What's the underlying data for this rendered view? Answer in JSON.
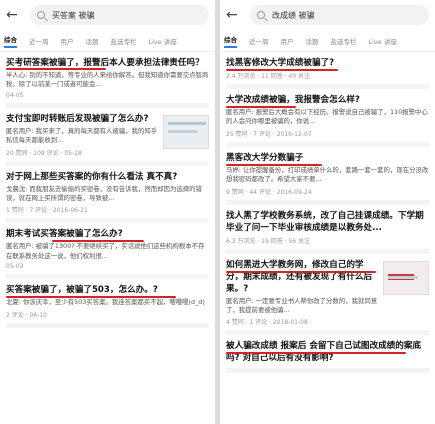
{
  "left": {
    "back_icon": "arrow-left-icon",
    "query": "买答案 被骗",
    "tabs": [
      "综合",
      "近一周",
      "用户",
      "话题",
      "盐选专栏",
      "Live 讲座"
    ],
    "items": [
      {
        "title": "买考研答案被骗了，报警后本人要承担法律责任吗？",
        "body": "半人心: 别的不知道，等专业的人来给你解答。但我知道你需要交点智商税。除了以前某一门或者可能会...",
        "meta": "04-05"
      },
      {
        "title": "支付宝即时转账后发现被骗了怎么办?",
        "body": "匿名用户: 我买来了，真的每天都有人被骗，我的知乎私信每天都能收到...",
        "meta": "20 赞同 · 109 评论 · 05-18"
      },
      {
        "title": "对于网上那些买答案的你有什么看法 真不真?",
        "body": "戈晨沈: 而我朋友去偷偷的买密卷，没有告诉我，然而却因为选择的错误，就在网上买所谓的密卷，导致被...",
        "meta": "1 赞同 · 7 评论 · 2016-06-21"
      },
      {
        "title": "期末考试买答案被骗了怎么办?",
        "body": "匿名用户: 被骗了1300? 不要继续买了，实话说他们这些机构根本不存在联系教务处这一说，他们权利很...",
        "meta": "05-03"
      },
      {
        "title": "买答案被骗了，被骗了503，怎么办。?",
        "body": "北夏: 你该庆幸，至少有503买答案。我连答案都买不起，嘤嘤嘤(d_d)",
        "meta": "2 评论 · 06-10"
      }
    ]
  },
  "right": {
    "back_icon": "arrow-left-icon",
    "query": "改成绩 被骗",
    "tabs": [
      "综合",
      "近一周",
      "用户",
      "话题",
      "盐选专栏",
      "Live 讲座"
    ],
    "items": [
      {
        "title": "找黑客修改大学成绩被骗了?",
        "body": "",
        "meta": "2.4 万浏览 · 11 回答 · 40 关注"
      },
      {
        "title": "大学改成绩被骗，我报警会怎么样?",
        "body": "匿名用户: 报警后大概会有以下经历。报警说自己被骗了，110报警中心的人会问你哪里被骗的，你说...",
        "meta": "25 赞同 · 7 评论 · 2016-12-07"
      },
      {
        "title": "黑客改大学分数骗子",
        "body": "马婷: 让你提醒备份，打印成绩单什么的，套路一套一套的，现在分没改想我密码都改了。希望大家不要...",
        "meta": "9 赞同 · 44 评论 · 2016-09-24"
      },
      {
        "title": "找人黑了学校教务系统，改了自己挂课成绩。下学期毕业了问一下毕业审核成绩是以教务处...",
        "body": "",
        "meta": "6.3 万浏览 · 19 回答 · 56 关注"
      },
      {
        "title": "如何黑进大学教务网，修改自己的学分，期末成绩，还有被发现了有什么后果。?",
        "body": "匿名用户: 一定要专业书人帮你改了分数的，我就同意了，我提前要被他骗...",
        "meta": "4 赞同 · 1 评论 · 2018-01-08"
      },
      {
        "title": "被人骗改成绩 报案后 会留下自己试图改成绩的案底吗? 对自己以后有没有影响?",
        "body": "",
        "meta": ""
      }
    ]
  },
  "colors": {
    "highlight": "#e8880f",
    "underline": "#d0232a",
    "tab_active": "#2b7be8"
  }
}
